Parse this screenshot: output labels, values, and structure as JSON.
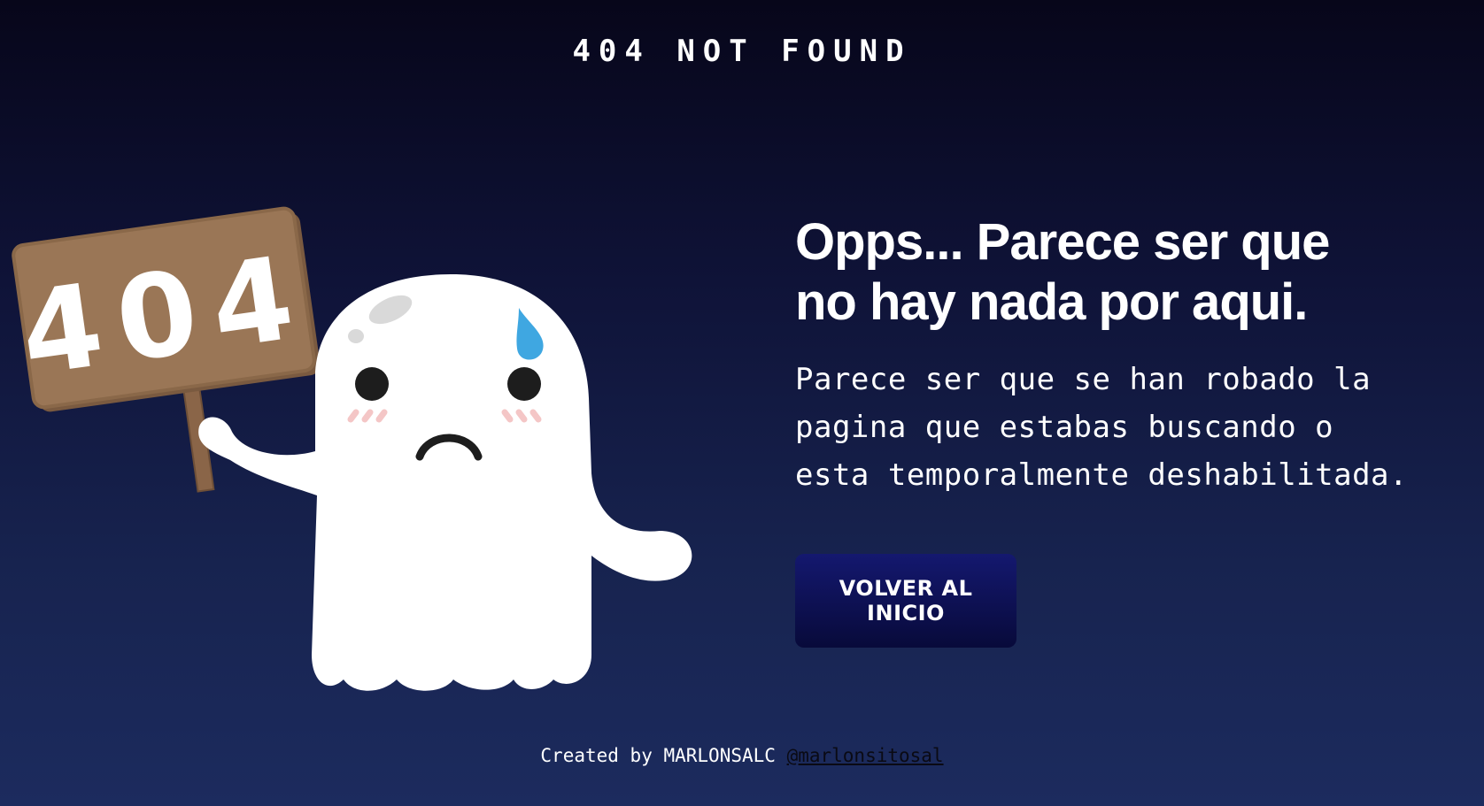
{
  "header": {
    "title": "404 NOT FOUND"
  },
  "illustration": {
    "sign_text": "404",
    "sign_color": "#9a7656",
    "ghost_color": "#ffffff",
    "tear_color": "#3fa7e1"
  },
  "main": {
    "headline_line1": "Opps... Parece ser que",
    "headline_line2": "no hay nada por aqui.",
    "description_line1": "Parece ser que se han robado la",
    "description_line2": "pagina que estabas buscando o",
    "description_line3": "esta temporalmente deshabilitada.",
    "button_label": "VOLVER AL INICIO"
  },
  "footer": {
    "prefix": "Created by MARLONSALC ",
    "link_text": "@marlonsitosal"
  },
  "colors": {
    "background_top": "#07061a",
    "background_bottom": "#1c2b5e",
    "button_top": "#14186f",
    "button_bottom": "#080a3a"
  }
}
